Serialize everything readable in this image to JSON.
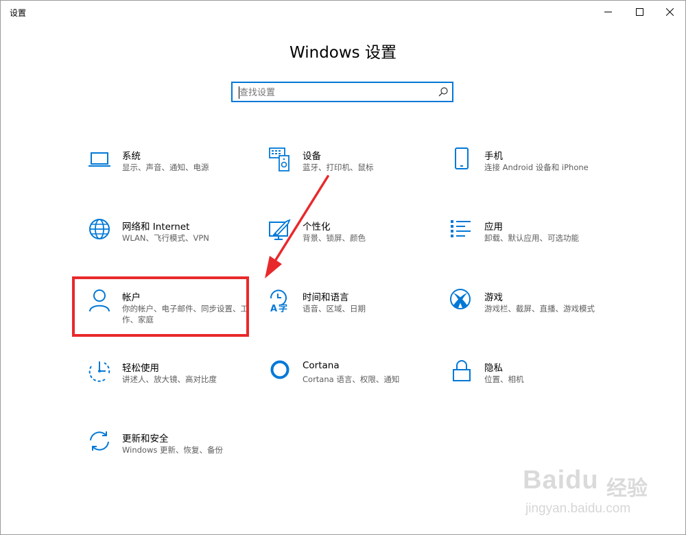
{
  "window": {
    "title": "设置"
  },
  "page_title": "Windows 设置",
  "search": {
    "placeholder": "查找设置",
    "value": ""
  },
  "tiles": [
    {
      "title": "系统",
      "desc": "显示、声音、通知、电源",
      "icon": "laptop-icon"
    },
    {
      "title": "设备",
      "desc": "蓝牙、打印机、鼠标",
      "icon": "devices-icon"
    },
    {
      "title": "手机",
      "desc": "连接 Android 设备和 iPhone",
      "icon": "phone-icon"
    },
    {
      "title": "网络和 Internet",
      "desc": "WLAN、飞行模式、VPN",
      "icon": "globe-icon"
    },
    {
      "title": "个性化",
      "desc": "背景、锁屏、颜色",
      "icon": "paint-icon"
    },
    {
      "title": "应用",
      "desc": "卸载、默认应用、可选功能",
      "icon": "apps-list-icon"
    },
    {
      "title": "帐户",
      "desc": "你的帐户、电子邮件、同步设置、工作、家庭",
      "icon": "person-icon"
    },
    {
      "title": "时间和语言",
      "desc": "语音、区域、日期",
      "icon": "time-language-icon"
    },
    {
      "title": "游戏",
      "desc": "游戏栏、截屏、直播、游戏模式",
      "icon": "xbox-icon"
    },
    {
      "title": "轻松使用",
      "desc": "讲述人、放大镜、高对比度",
      "icon": "ease-of-access-icon"
    },
    {
      "title": "Cortana",
      "desc": "Cortana 语言、权限、通知",
      "icon": "cortana-icon"
    },
    {
      "title": "隐私",
      "desc": "位置、相机",
      "icon": "lock-icon"
    },
    {
      "title": "更新和安全",
      "desc": "Windows 更新、恢复、备份",
      "icon": "sync-icon"
    }
  ],
  "colors": {
    "accent": "#0078d7",
    "annotation": "#e8292b",
    "watermark": "#dadada"
  },
  "watermark": {
    "logo": "Baidu",
    "cn": "经验",
    "url": "jingyan.baidu.com"
  }
}
